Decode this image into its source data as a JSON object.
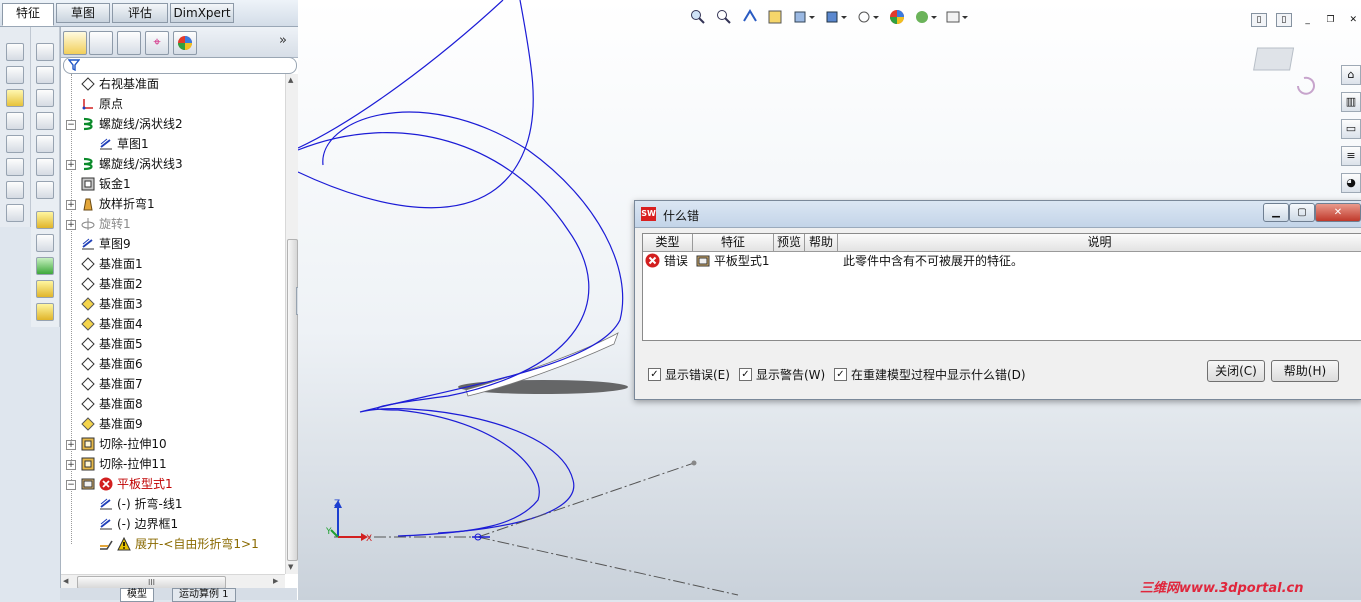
{
  "command_tabs": [
    "特征",
    "草图",
    "评估",
    "DimXpert"
  ],
  "feature_tree": [
    {
      "label": "右视基准面",
      "icon": "plane-icon",
      "indent": 1,
      "expander": ""
    },
    {
      "label": "原点",
      "icon": "origin-icon",
      "indent": 1,
      "expander": ""
    },
    {
      "label": "螺旋线/涡状线2",
      "icon": "helix-icon",
      "indent": 1,
      "expander": "−"
    },
    {
      "label": "草图1",
      "icon": "sketch-icon",
      "indent": 2,
      "expander": ""
    },
    {
      "label": "螺旋线/涡状线3",
      "icon": "helix-icon",
      "indent": 1,
      "expander": "+"
    },
    {
      "label": "钣金1",
      "icon": "sheet-metal-icon",
      "indent": 1,
      "expander": ""
    },
    {
      "label": "放样折弯1",
      "icon": "lofted-bend-icon",
      "indent": 1,
      "expander": "+"
    },
    {
      "label": "旋转1",
      "icon": "revolve-icon",
      "indent": 1,
      "expander": "+",
      "greyed": true
    },
    {
      "label": "草图9",
      "icon": "sketch-icon",
      "indent": 1,
      "expander": ""
    },
    {
      "label": "基准面1",
      "icon": "plane-icon",
      "indent": 1,
      "expander": ""
    },
    {
      "label": "基准面2",
      "icon": "plane-icon",
      "indent": 1,
      "expander": ""
    },
    {
      "label": "基准面3",
      "icon": "plane-yellow-icon",
      "indent": 1,
      "expander": ""
    },
    {
      "label": "基准面4",
      "icon": "plane-yellow-icon",
      "indent": 1,
      "expander": ""
    },
    {
      "label": "基准面5",
      "icon": "plane-icon",
      "indent": 1,
      "expander": ""
    },
    {
      "label": "基准面6",
      "icon": "plane-icon",
      "indent": 1,
      "expander": ""
    },
    {
      "label": "基准面7",
      "icon": "plane-icon",
      "indent": 1,
      "expander": ""
    },
    {
      "label": "基准面8",
      "icon": "plane-icon",
      "indent": 1,
      "expander": ""
    },
    {
      "label": "基准面9",
      "icon": "plane-yellow-icon",
      "indent": 1,
      "expander": ""
    },
    {
      "label": "切除-拉伸10",
      "icon": "cut-extrude-icon",
      "indent": 1,
      "expander": "+"
    },
    {
      "label": "切除-拉伸11",
      "icon": "cut-extrude-icon",
      "indent": 1,
      "expander": "+"
    },
    {
      "label": "平板型式1",
      "icon": "flat-pattern-icon",
      "indent": 1,
      "expander": "−",
      "error": true
    },
    {
      "label": "(-) 折弯-线1",
      "icon": "sketch-icon",
      "indent": 2,
      "expander": ""
    },
    {
      "label": "(-) 边界框1",
      "icon": "sketch-icon",
      "indent": 2,
      "expander": ""
    },
    {
      "label": "展开-<自由形折弯1>1",
      "icon": "unfold-icon",
      "indent": 2,
      "expander": "",
      "warning": true
    }
  ],
  "hscroll_label": "III",
  "bottom_tabs": [
    "模型",
    "运动算例 1"
  ],
  "colors": {
    "accent": "#1a3fbf",
    "error": "#d21f1f",
    "warning": "#e8c400",
    "error_text": "#c00000"
  },
  "dialog": {
    "title": "什么错",
    "columns": [
      "类型",
      "特征",
      "预览",
      "帮助",
      "说明"
    ],
    "rows": [
      {
        "type": "错误",
        "feature": "平板型式1",
        "preview": "",
        "help": "",
        "description": "此零件中含有不可被展开的特征。"
      }
    ],
    "checkboxes": [
      {
        "label": "显示错误(E)",
        "checked": true
      },
      {
        "label": "显示警告(W)",
        "checked": true
      },
      {
        "label": "在重建模型过程中显示什么错(D)",
        "checked": true
      }
    ],
    "buttons": {
      "close": "关闭(C)",
      "help": "帮助(H)"
    }
  },
  "axis_labels": {
    "x": "X",
    "y": "Y",
    "z": "Z"
  },
  "watermark": "三维网www.3dportal.cn"
}
